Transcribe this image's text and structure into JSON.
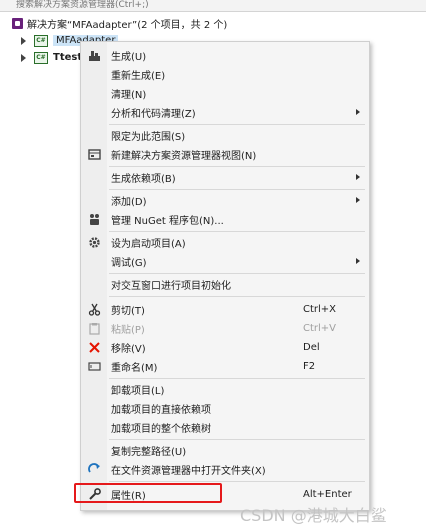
{
  "search": {
    "placeholder": "搜索解决方案资源管理器(Ctrl+;)"
  },
  "tree": {
    "solution": "解决方案“MFAadapter”(2 个项目，共 2 个)",
    "project1": "MFAadapter",
    "project2": "Ttest"
  },
  "menu": {
    "build": "生成(U)",
    "rebuild": "重新生成(E)",
    "clean": "清理(N)",
    "analyze": "分析和代码清理(Z)",
    "scope": "限定为此范围(S)",
    "new_view": "新建解决方案资源管理器视图(N)",
    "build_deps": "生成依赖项(B)",
    "add": "添加(D)",
    "nuget": "管理 NuGet 程序包(N)...",
    "startup": "设为启动项目(A)",
    "debug": "调试(G)",
    "interactive": "对交互窗口进行项目初始化",
    "cut": "剪切(T)",
    "cut_sc": "Ctrl+X",
    "paste": "粘贴(P)",
    "paste_sc": "Ctrl+V",
    "remove": "移除(V)",
    "remove_sc": "Del",
    "rename": "重命名(M)",
    "rename_sc": "F2",
    "unload": "卸载项目(L)",
    "load_direct": "加载项目的直接依赖项",
    "load_tree": "加载项目的整个依赖树",
    "copy_path": "复制完整路径(U)",
    "open_folder": "在文件资源管理器中打开文件夹(X)",
    "properties": "属性(R)",
    "properties_sc": "Alt+Enter"
  },
  "watermark": "CSDN @港城大白鲨",
  "colors": {
    "highlight": "#e5191b",
    "remove_icon": "#e51400",
    "refresh_icon": "#1e73be"
  }
}
